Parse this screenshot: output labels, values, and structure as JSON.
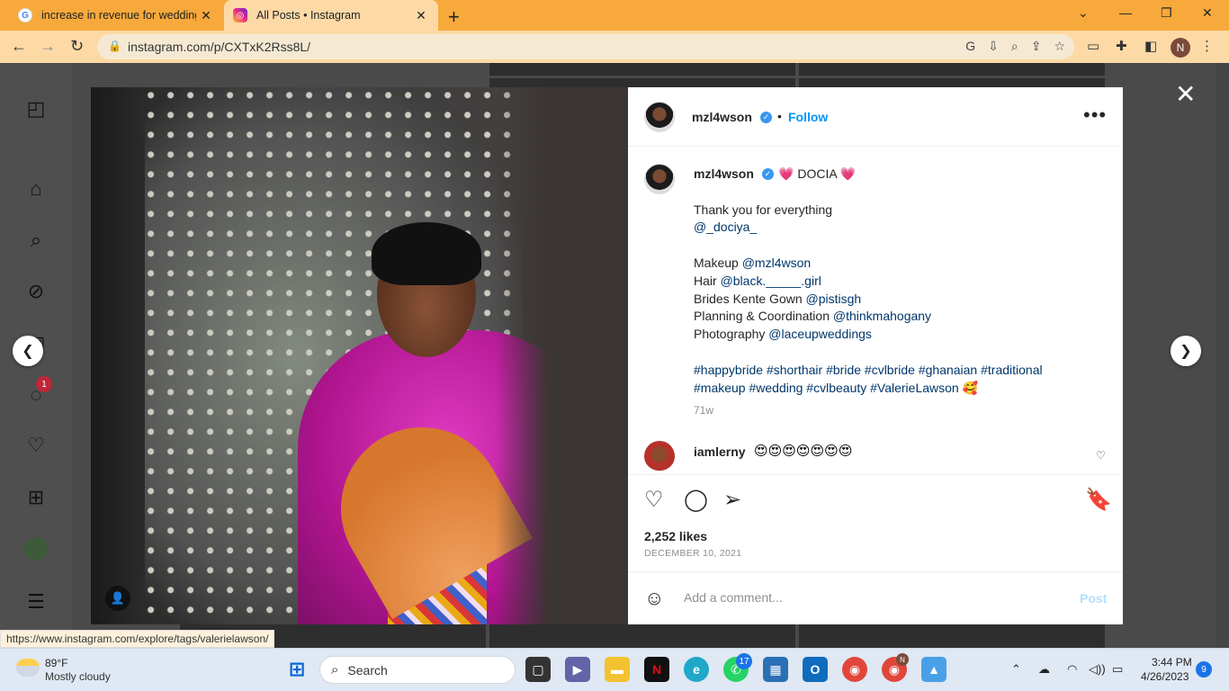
{
  "browser": {
    "tabs": [
      {
        "title": "increase in revenue for wedding",
        "favicon": "google-icon",
        "active": false
      },
      {
        "title": "All Posts • Instagram",
        "favicon": "instagram-icon",
        "active": true
      }
    ],
    "new_tab": "+",
    "url": "instagram.com/p/CXTxK2Rss8L/",
    "profile_initial": "N",
    "status_url": "https://www.instagram.com/explore/tags/valerielawson/"
  },
  "sidebar": {
    "icons": [
      "instagram-logo-icon",
      "home-icon",
      "search-icon",
      "explore-icon",
      "reels-icon",
      "messenger-icon",
      "heart-icon",
      "create-icon",
      "profile-avatar",
      "menu-icon"
    ],
    "messages_badge": "1"
  },
  "post": {
    "author": "mzl4wson",
    "follow_label": "Follow",
    "separator": "•",
    "more_label": "•••",
    "caption": {
      "title_left": "💗",
      "title_text": "DOCIA",
      "title_right": "💗",
      "line1": "Thank you for everything",
      "mention1": "@_dociya_",
      "credits": [
        {
          "label": "Makeup",
          "handle": "@mzl4wson"
        },
        {
          "label": "Hair",
          "handle": "@black._____.girl"
        },
        {
          "label": "Brides Kente Gown",
          "handle": "@pistisgh"
        },
        {
          "label": "Planning & Coordination",
          "handle": "@thinkmahogany"
        },
        {
          "label": "Photography",
          "handle": "@laceupweddings"
        }
      ],
      "hashtags_line1": "#happybride #shorthair #bride #cvlbride #ghanaian #traditional",
      "hashtags_line2": "#makeup #wedding #cvlbeauty #ValerieLawson",
      "hashtags_emoji": "🥰"
    },
    "age": "71w",
    "comment": {
      "user": "iamlerny",
      "text": "😍😍😍😍😍😍😍"
    },
    "likes": "2,252 likes",
    "date": "DECEMBER 10, 2021",
    "comment_placeholder": "Add a comment...",
    "post_label": "Post"
  },
  "taskbar": {
    "weather_temp": "89°F",
    "weather_desc": "Mostly cloudy",
    "search_label": "Search",
    "whatsapp_badge": "17",
    "chrome_profile_badge": "N",
    "time": "3:44 PM",
    "date": "4/26/2023",
    "notification_count": "9"
  },
  "colors": {
    "tabbar": "#f7a93b",
    "toolbar": "#fdd9a6",
    "ig_link": "#00376b",
    "ig_blue": "#0095f6"
  }
}
